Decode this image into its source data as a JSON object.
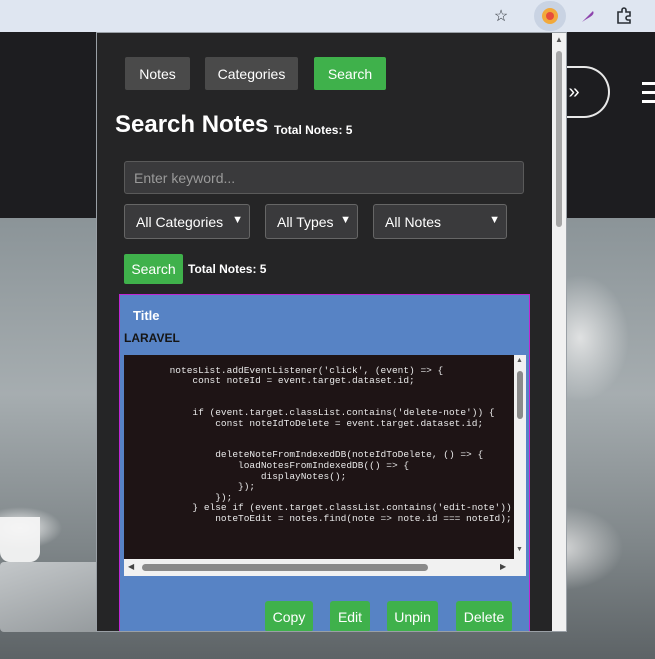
{
  "chrome": {
    "icons": [
      "star-icon",
      "extension-active-icon",
      "feather-icon",
      "puzzle-icon"
    ]
  },
  "background": {
    "cta_label": "»"
  },
  "popup": {
    "tabs": [
      {
        "label": "Notes"
      },
      {
        "label": "Categories"
      },
      {
        "label": "Search"
      }
    ],
    "heading": "Search Notes",
    "total_notes_header": "Total Notes: 5",
    "keyword_placeholder": "Enter keyword...",
    "filters": {
      "category": "All Categories",
      "type": "All Types",
      "notes": "All Notes"
    },
    "search_button": "Search",
    "total_notes": "Total Notes: 5",
    "card": {
      "title": "Title",
      "category": "LARAVEL",
      "code": "\n        notesList.addEventListener('click', (event) => {\n            const noteId = event.target.dataset.id;\n\n\n            if (event.target.classList.contains('delete-note')) {\n                const noteIdToDelete = event.target.dataset.id;\n\n\n                deleteNoteFromIndexedDB(noteIdToDelete, () => {\n                    loadNotesFromIndexedDB(() => {\n                        displayNotes();\n                    });\n                });\n            } else if (event.target.classList.contains('edit-note')) {\n                noteToEdit = notes.find(note => note.id === noteId);",
      "buttons": {
        "copy": "Copy",
        "edit": "Edit",
        "unpin": "Unpin",
        "delete": "Delete"
      }
    }
  },
  "colors": {
    "accent_green": "#3fb14b",
    "card_blue": "#5783c5",
    "card_border": "#c026d3"
  }
}
